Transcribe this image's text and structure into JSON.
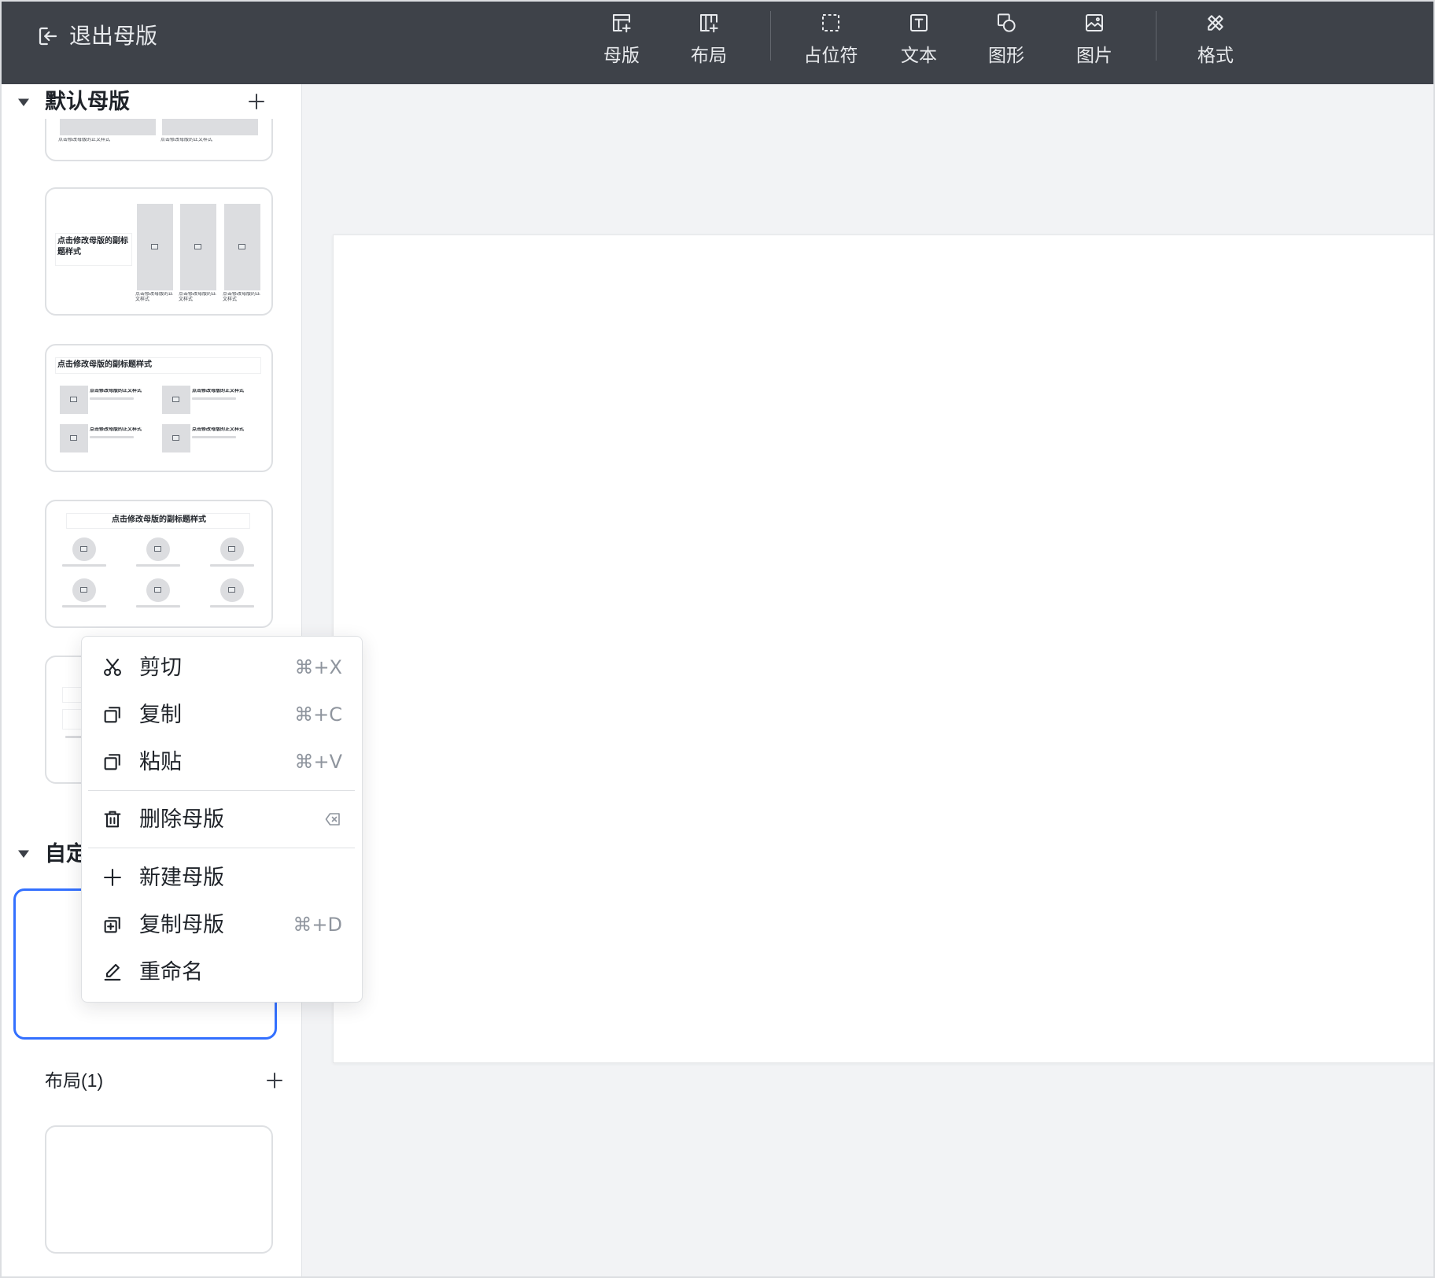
{
  "topbar": {
    "exit_label": "退出母版",
    "exit_icon": "exit-icon",
    "tools": [
      {
        "label": "母版",
        "icon": "master-icon"
      },
      {
        "label": "布局",
        "icon": "layout-icon"
      },
      {
        "label": "占位符",
        "icon": "placeholder-icon"
      },
      {
        "label": "文本",
        "icon": "text-icon"
      },
      {
        "label": "图形",
        "icon": "shape-icon"
      },
      {
        "label": "图片",
        "icon": "image-icon"
      },
      {
        "label": "格式",
        "icon": "format-icon"
      }
    ]
  },
  "sidebar": {
    "default_section_title": "默认母版",
    "custom_section_title": "自定",
    "layout_section_title": "布局(1)",
    "thumbnail_texts": {
      "subtitle": "点击修改母版的副标题样式",
      "body": "点击修改母版的正文样式"
    }
  },
  "context_menu": {
    "items": [
      {
        "label": "剪切",
        "shortcut": "⌘+X",
        "icon": "scissors-icon"
      },
      {
        "label": "复制",
        "shortcut": "⌘+C",
        "icon": "copy-icon"
      },
      {
        "label": "粘贴",
        "shortcut": "⌘+V",
        "icon": "paste-icon"
      },
      {
        "label": "删除母版",
        "shortcut_icon": "backspace-icon",
        "icon": "trash-icon"
      },
      {
        "label": "新建母版",
        "icon": "plus-icon"
      },
      {
        "label": "复制母版",
        "shortcut": "⌘+D",
        "icon": "duplicate-icon"
      },
      {
        "label": "重命名",
        "icon": "pencil-icon"
      }
    ]
  },
  "colors": {
    "topbar_bg": "#3e4249",
    "accent": "#3370ff",
    "canvas_bg": "#f2f3f5"
  }
}
